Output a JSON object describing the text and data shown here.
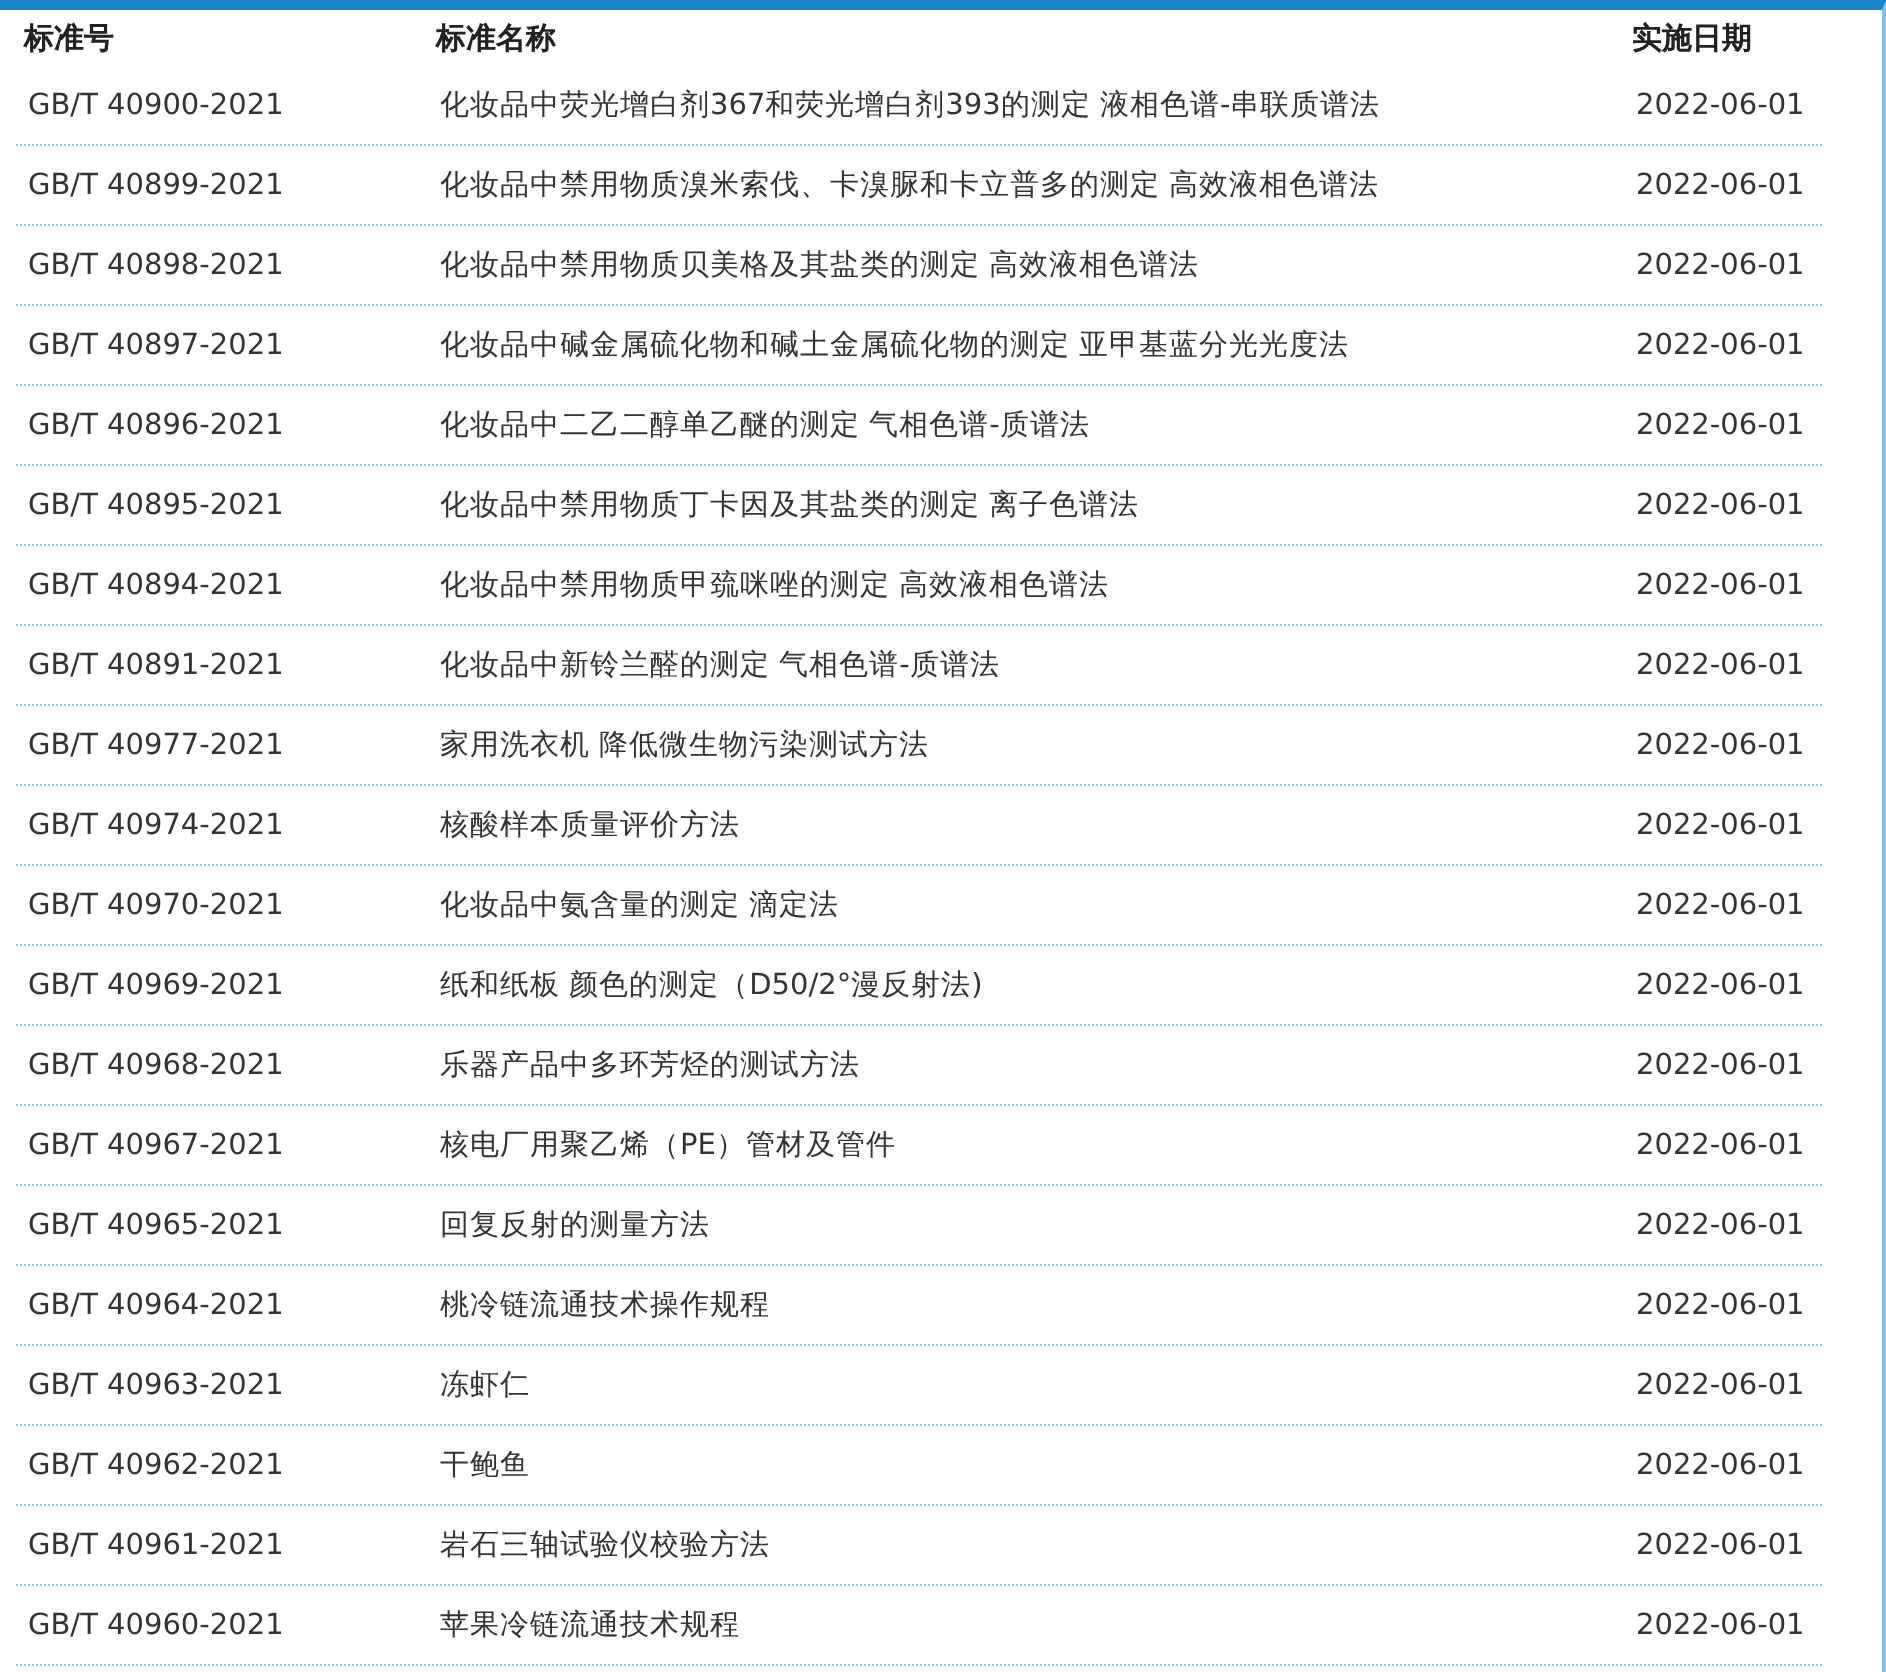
{
  "table": {
    "columns": [
      "标准号",
      "标准名称",
      "实施日期"
    ],
    "rows": [
      [
        "GB/T 40900-2021",
        "化妆品中荧光增白剂367和荧光增白剂393的测定 液相色谱-串联质谱法",
        "2022-06-01"
      ],
      [
        "GB/T 40899-2021",
        "化妆品中禁用物质溴米索伐、卡溴脲和卡立普多的测定 高效液相色谱法",
        "2022-06-01"
      ],
      [
        "GB/T 40898-2021",
        "化妆品中禁用物质贝美格及其盐类的测定 高效液相色谱法",
        "2022-06-01"
      ],
      [
        "GB/T 40897-2021",
        "化妆品中碱金属硫化物和碱土金属硫化物的测定 亚甲基蓝分光光度法",
        "2022-06-01"
      ],
      [
        "GB/T 40896-2021",
        "化妆品中二乙二醇单乙醚的测定 气相色谱-质谱法",
        "2022-06-01"
      ],
      [
        "GB/T 40895-2021",
        "化妆品中禁用物质丁卡因及其盐类的测定 离子色谱法",
        "2022-06-01"
      ],
      [
        "GB/T 40894-2021",
        "化妆品中禁用物质甲巯咪唑的测定 高效液相色谱法",
        "2022-06-01"
      ],
      [
        "GB/T 40891-2021",
        "化妆品中新铃兰醛的测定 气相色谱-质谱法",
        "2022-06-01"
      ],
      [
        "GB/T 40977-2021",
        "家用洗衣机 降低微生物污染测试方法",
        "2022-06-01"
      ],
      [
        "GB/T 40974-2021",
        "核酸样本质量评价方法",
        "2022-06-01"
      ],
      [
        "GB/T 40970-2021",
        "化妆品中氨含量的测定 滴定法",
        "2022-06-01"
      ],
      [
        "GB/T 40969-2021",
        "纸和纸板 颜色的测定（D50/2°漫反射法)",
        "2022-06-01"
      ],
      [
        "GB/T 40968-2021",
        "乐器产品中多环芳烃的测试方法",
        "2022-06-01"
      ],
      [
        "GB/T 40967-2021",
        "核电厂用聚乙烯（PE）管材及管件",
        "2022-06-01"
      ],
      [
        "GB/T 40965-2021",
        "回复反射的测量方法",
        "2022-06-01"
      ],
      [
        "GB/T 40964-2021",
        "桃冷链流通技术操作规程",
        "2022-06-01"
      ],
      [
        "GB/T 40963-2021",
        "冻虾仁",
        "2022-06-01"
      ],
      [
        "GB/T 40962-2021",
        "干鲍鱼",
        "2022-06-01"
      ],
      [
        "GB/T 40961-2021",
        "岩石三轴试验仪校验方法",
        "2022-06-01"
      ],
      [
        "GB/T 40960-2021",
        "苹果冷链流通技术规程",
        "2022-06-01"
      ]
    ]
  }
}
